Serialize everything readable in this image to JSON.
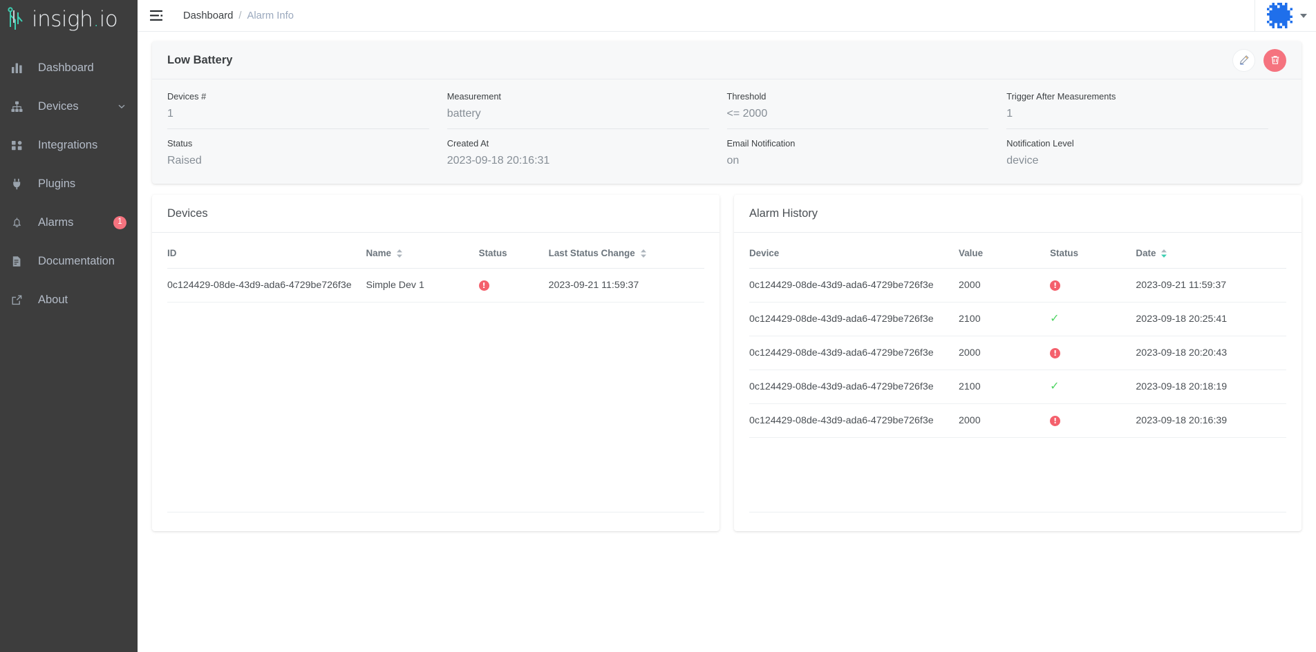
{
  "brand": {
    "name": "insigh",
    "dot": ".",
    "suffix": "io"
  },
  "sidebar": {
    "items": [
      {
        "label": "Dashboard",
        "icon": "bar-chart-icon",
        "badge": null,
        "chevron": false
      },
      {
        "label": "Devices",
        "icon": "sitemap-icon",
        "badge": null,
        "chevron": true
      },
      {
        "label": "Integrations",
        "icon": "grid-icon",
        "badge": null,
        "chevron": false
      },
      {
        "label": "Plugins",
        "icon": "plug-icon",
        "badge": null,
        "chevron": false
      },
      {
        "label": "Alarms",
        "icon": "bell-icon",
        "badge": "1",
        "chevron": false
      },
      {
        "label": "Documentation",
        "icon": "document-icon",
        "badge": null,
        "chevron": false
      },
      {
        "label": "About",
        "icon": "external-link-icon",
        "badge": null,
        "chevron": false
      }
    ]
  },
  "topbar": {
    "menu_icon": "hamburger-icon",
    "breadcrumb": {
      "root": "Dashboard",
      "separator": "/",
      "current": "Alarm Info"
    },
    "avatar_alt": "user-identicon",
    "caret_icon": "chevron-down-icon"
  },
  "alarm": {
    "title": "Low Battery",
    "edit_icon": "pencil-icon",
    "delete_icon": "trash-icon",
    "fields": [
      {
        "label": "Devices #",
        "value": "1"
      },
      {
        "label": "Measurement",
        "value": "battery"
      },
      {
        "label": "Threshold",
        "value": "<= 2000"
      },
      {
        "label": "Trigger After Measurements",
        "value": "1"
      },
      {
        "label": "Status",
        "value": "Raised"
      },
      {
        "label": "Created At",
        "value": "2023-09-18 20:16:31"
      },
      {
        "label": "Email Notification",
        "value": "on"
      },
      {
        "label": "Notification Level",
        "value": "device"
      }
    ]
  },
  "devices_panel": {
    "title": "Devices",
    "columns": [
      {
        "label": "ID",
        "sortable": false,
        "sort": "none"
      },
      {
        "label": "Name",
        "sortable": true,
        "sort": "none"
      },
      {
        "label": "Status",
        "sortable": false,
        "sort": "none"
      },
      {
        "label": "Last Status Change",
        "sortable": true,
        "sort": "none"
      }
    ],
    "rows": [
      {
        "id": "0c124429-08de-43d9-ada6-4729be726f3e",
        "name": "Simple Dev 1",
        "status": "alert",
        "last_status_change": "2023-09-21 11:59:37"
      }
    ]
  },
  "history_panel": {
    "title": "Alarm History",
    "columns": [
      {
        "label": "Device",
        "sortable": false,
        "sort": "none"
      },
      {
        "label": "Value",
        "sortable": false,
        "sort": "none"
      },
      {
        "label": "Status",
        "sortable": false,
        "sort": "none"
      },
      {
        "label": "Date",
        "sortable": true,
        "sort": "desc"
      }
    ],
    "rows": [
      {
        "device": "0c124429-08de-43d9-ada6-4729be726f3e",
        "value": "2000",
        "status": "alert",
        "date": "2023-09-21 11:59:37"
      },
      {
        "device": "0c124429-08de-43d9-ada6-4729be726f3e",
        "value": "2100",
        "status": "ok",
        "date": "2023-09-18 20:25:41"
      },
      {
        "device": "0c124429-08de-43d9-ada6-4729be726f3e",
        "value": "2000",
        "status": "alert",
        "date": "2023-09-18 20:20:43"
      },
      {
        "device": "0c124429-08de-43d9-ada6-4729be726f3e",
        "value": "2100",
        "status": "ok",
        "date": "2023-09-18 20:18:19"
      },
      {
        "device": "0c124429-08de-43d9-ada6-4729be726f3e",
        "value": "2000",
        "status": "alert",
        "date": "2023-09-18 20:16:39"
      }
    ]
  },
  "colors": {
    "sidebar_bg": "#3d3d3d",
    "accent_teal": "#3ecfb2",
    "danger": "#f5737f",
    "success": "#4fd463",
    "muted_text": "#868e96",
    "avatar_blue": "#1f6feb"
  }
}
